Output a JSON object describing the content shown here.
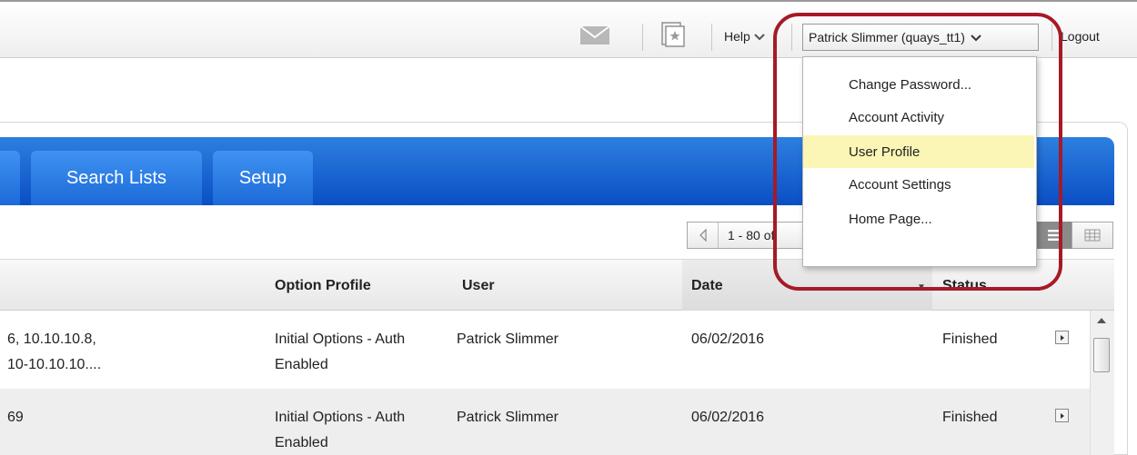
{
  "header": {
    "help_label": "Help",
    "user_label": "Patrick Slimmer (quays_tt1)",
    "logout_label": "Logout",
    "icons": [
      "mail-icon",
      "report-icon",
      "chevron-down-icon"
    ]
  },
  "tabs": [
    {
      "label": "Search Lists"
    },
    {
      "label": "Setup"
    }
  ],
  "pager": {
    "text": "1 - 80 of"
  },
  "table": {
    "columns": {
      "option_profile": "Option Profile",
      "user": "User",
      "date": "Date",
      "status": "Status"
    },
    "rows": [
      {
        "target_line1": "6, 10.10.10.8,",
        "target_line2": "10-10.10.10....",
        "option_line1": "Initial Options - Auth",
        "option_line2": "Enabled",
        "user": "Patrick Slimmer",
        "date": "06/02/2016",
        "status": "Finished"
      },
      {
        "target_line1": "69",
        "target_line2": "",
        "option_line1": "Initial Options - Auth",
        "option_line2": "Enabled",
        "user": "Patrick Slimmer",
        "date": "06/02/2016",
        "status": "Finished"
      }
    ]
  },
  "user_menu": {
    "items": [
      {
        "label": "Change Password..."
      },
      {
        "label": "Account Activity"
      },
      {
        "label": "User Profile"
      },
      {
        "label": "Account Settings"
      },
      {
        "label": "Home Page..."
      }
    ],
    "highlighted_item": "User Profile"
  },
  "colors": {
    "tab_blue": "#1c6ad8",
    "highlight_yellow": "#fbf6b5",
    "annotation_red": "#a51a26"
  }
}
